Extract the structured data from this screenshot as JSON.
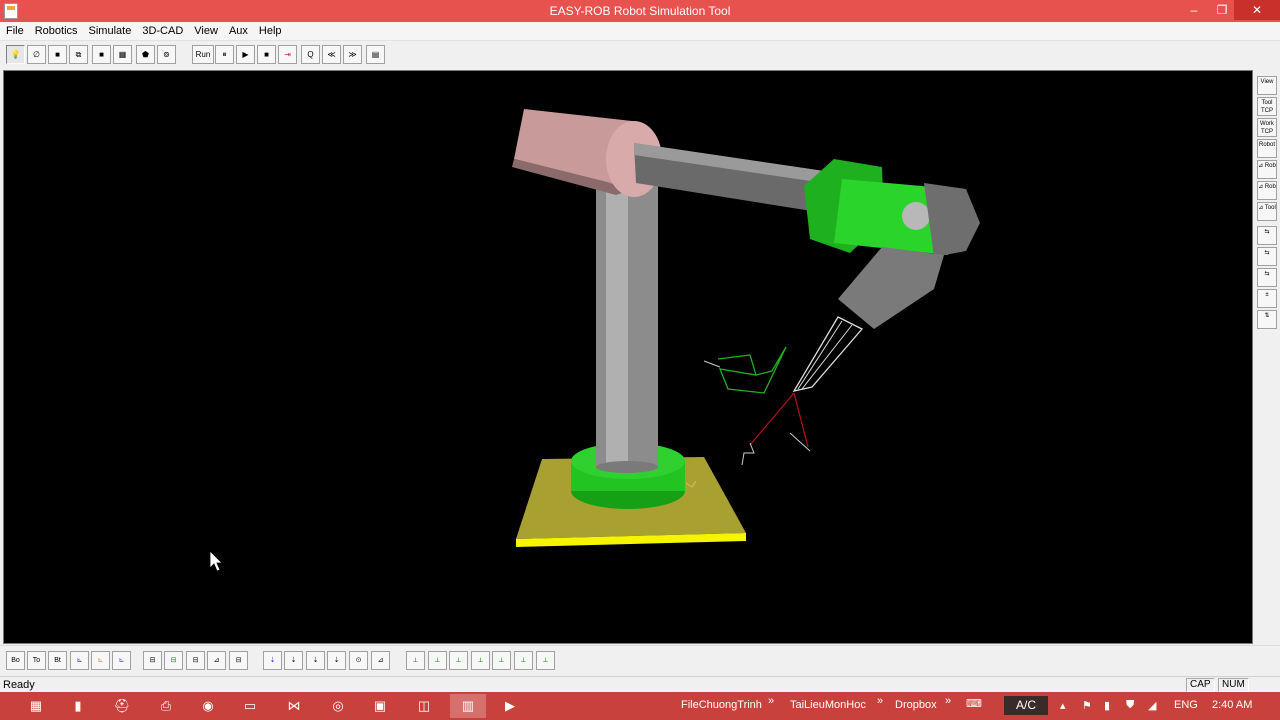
{
  "window": {
    "title": "EASY-ROB Robot Simulation Tool",
    "minimize": "‒",
    "restore": "❐",
    "close": "✕"
  },
  "menu": [
    "File",
    "Robotics",
    "Simulate",
    "3D-CAD",
    "View",
    "Aux",
    "Help"
  ],
  "toolbar": {
    "group1": [
      "💡",
      "∅",
      "■",
      "⧉",
      "■",
      "▦",
      "⬟",
      "⊚"
    ],
    "run_label": "Run",
    "group2": [
      "⏸",
      "▶",
      "■",
      "⇥",
      "Q",
      "≪",
      "≫",
      "▤"
    ]
  },
  "right_toolbar": [
    "View",
    "Tool TCP",
    "Work TCP",
    "Robot",
    "⊿ Rob",
    "⊿ Rob",
    "⊿ Tool",
    "⇆",
    "⇆",
    "⇆",
    "±",
    "⇅"
  ],
  "bottom_toolbar": {
    "frames": [
      "Bo",
      "To",
      "Bt"
    ],
    "group1": [
      "⊾",
      "⊾",
      "⊾"
    ],
    "group2": [
      "⊟",
      "⊟",
      "⊟",
      "⊿",
      "⊟"
    ],
    "group3": [
      "⇣",
      "⇣",
      "⇣",
      "⇣",
      "⊙",
      "⊿"
    ],
    "group4": [
      "⟂",
      "⟂",
      "⟂",
      "⟂",
      "⟂",
      "⟂",
      "⟂"
    ]
  },
  "status": {
    "text": "Ready",
    "cap": "CAP",
    "num": "NUM"
  },
  "taskbar": {
    "apps": [
      "▦",
      "▮",
      "⛑",
      "⎙",
      "◉",
      "▭",
      "⋈",
      "◎",
      "▣",
      "◫",
      "▥",
      "▶"
    ],
    "links": [
      "FileChuongTrinh",
      "TaiLieuMonHoc",
      "Dropbox"
    ],
    "link_chevron": "»",
    "ime": "A/C",
    "tray_icons": [
      "▴",
      "⚑",
      "▮",
      "⛊",
      "◢"
    ],
    "lang": "ENG",
    "time": "2:40 AM"
  },
  "colors": {
    "titlebar": "#e8524e",
    "taskbar": "#c9413c",
    "viewport": "#000000",
    "robot_green": "#22c422",
    "robot_gray": "#8c8c8c",
    "link_pink": "#c99a9a",
    "base_yellow": "#a9a032"
  }
}
